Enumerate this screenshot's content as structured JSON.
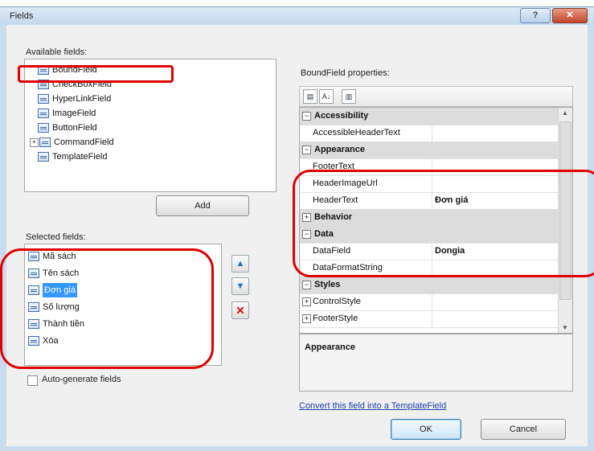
{
  "window": {
    "title": "Fields"
  },
  "available": {
    "label": "Available fields:",
    "items": [
      "BoundField",
      "CheckBoxField",
      "HyperLinkField",
      "ImageField",
      "ButtonField",
      "CommandField",
      "TemplateField"
    ],
    "add_button": "Add"
  },
  "selected": {
    "label": "Selected fields:",
    "items": [
      "Mã sách",
      "Tên sách",
      "Đơn giá",
      "Số lượng",
      "Thành tiền",
      "Xóa"
    ],
    "selected_index": 2
  },
  "autogen": {
    "label": "Auto-generate fields",
    "checked": false
  },
  "properties": {
    "title": "BoundField properties:",
    "rows": [
      {
        "type": "category",
        "name": "Accessibility",
        "expanded": true
      },
      {
        "type": "prop",
        "name": "AccessibleHeaderText",
        "value": ""
      },
      {
        "type": "category",
        "name": "Appearance",
        "expanded": true
      },
      {
        "type": "prop",
        "name": "FooterText",
        "value": ""
      },
      {
        "type": "prop",
        "name": "HeaderImageUrl",
        "value": ""
      },
      {
        "type": "prop",
        "name": "HeaderText",
        "value": "Đơn giá"
      },
      {
        "type": "category",
        "name": "Behavior",
        "expanded": false
      },
      {
        "type": "category",
        "name": "Data",
        "expanded": true
      },
      {
        "type": "prop",
        "name": "DataField",
        "value": "Dongia"
      },
      {
        "type": "prop",
        "name": "DataFormatString",
        "value": ""
      },
      {
        "type": "category",
        "name": "Styles",
        "expanded": true
      },
      {
        "type": "prop",
        "name": "ControlStyle",
        "value": "",
        "expand": true
      },
      {
        "type": "prop",
        "name": "FooterStyle",
        "value": "",
        "expand": true
      }
    ],
    "description_title": "Appearance"
  },
  "convert_link": "Convert this field into a TemplateField",
  "buttons": {
    "ok": "OK",
    "cancel": "Cancel"
  },
  "colors": {
    "highlight": "#e00000",
    "selection": "#3399ff"
  }
}
